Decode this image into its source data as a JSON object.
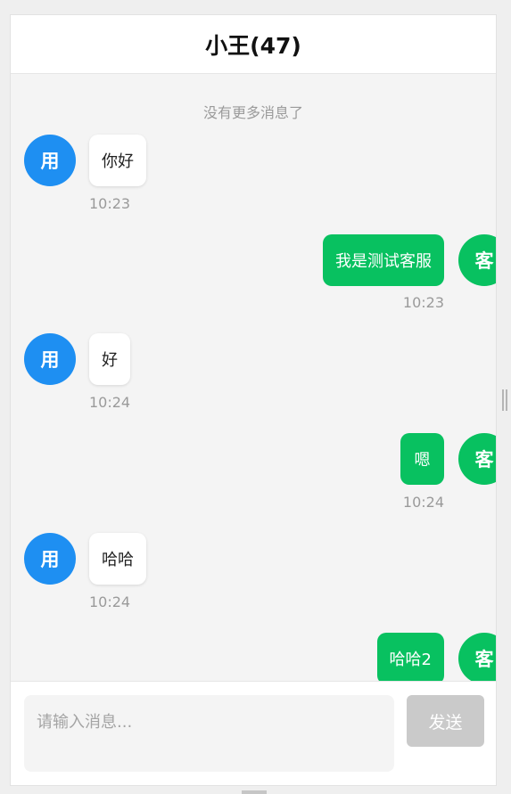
{
  "header": {
    "title": "小王(47)"
  },
  "messages": {
    "no_more_text": "没有更多消息了",
    "items": [
      {
        "sender": "user",
        "avatar_text": "用",
        "text": "你好",
        "time": "10:23"
      },
      {
        "sender": "agent",
        "avatar_text": "客",
        "text": "我是测试客服",
        "time": "10:23"
      },
      {
        "sender": "user",
        "avatar_text": "用",
        "text": "好",
        "time": "10:24"
      },
      {
        "sender": "agent",
        "avatar_text": "客",
        "text": "嗯",
        "time": "10:24"
      },
      {
        "sender": "user",
        "avatar_text": "用",
        "text": "哈哈",
        "time": "10:24"
      },
      {
        "sender": "agent",
        "avatar_text": "客",
        "text": "哈哈2",
        "time": ""
      }
    ]
  },
  "composer": {
    "input_value": "",
    "input_placeholder": "请输入消息...",
    "send_label": "发送"
  },
  "colors": {
    "user_avatar": "#1e8ff2",
    "agent_accent": "#08c160",
    "send_disabled": "#cacaca"
  }
}
